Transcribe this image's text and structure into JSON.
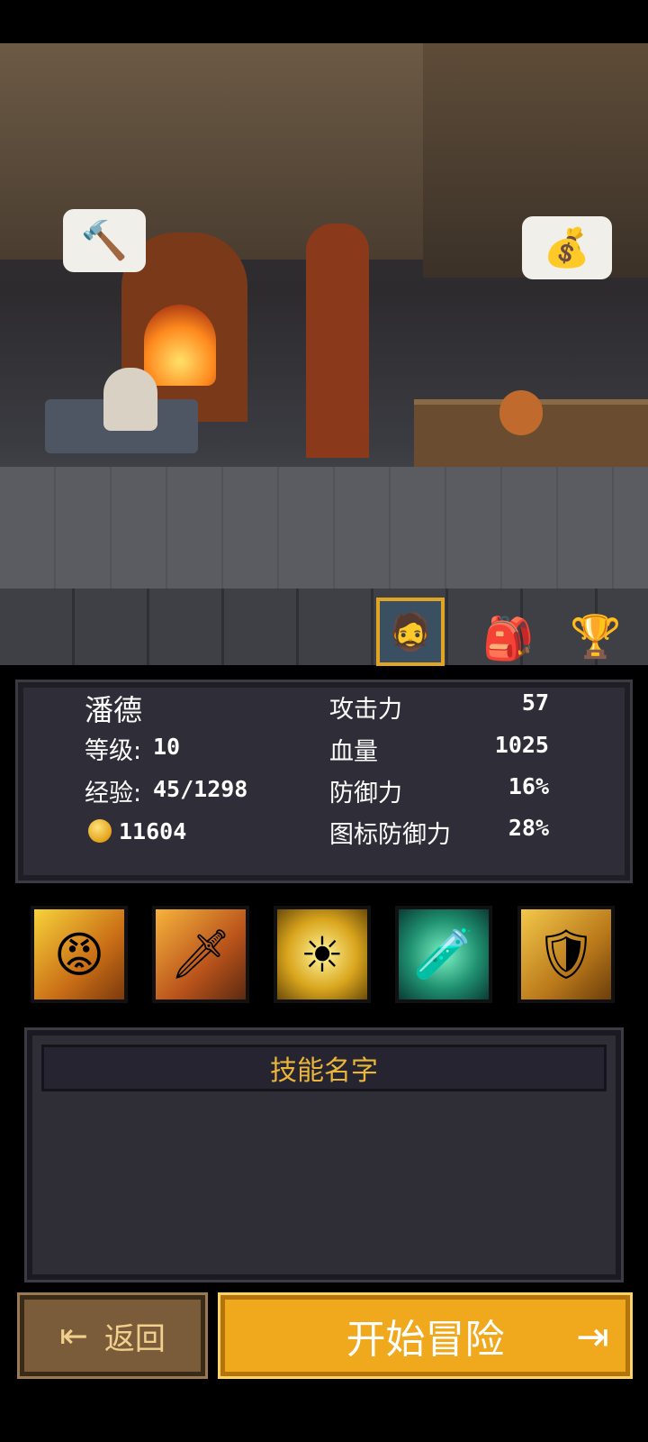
{
  "scene": {
    "hammer_icon": "hammer-icon",
    "gold_icon": "gold-bag-icon",
    "hammer_glyph": "🔨",
    "gold_glyph": "💰"
  },
  "tabs": {
    "portrait_glyph": "🧔",
    "bag_glyph": "🎒",
    "trophy_glyph": "🏆"
  },
  "character": {
    "name": "潘德",
    "level_label": "等级:",
    "level_value": "10",
    "exp_label": "经验:",
    "exp_value": "45/1298",
    "gold_value": "11604"
  },
  "attributes": [
    {
      "label": "攻击力",
      "value": "57"
    },
    {
      "label": "血量",
      "value": "1025"
    },
    {
      "label": "防御力",
      "value": "16%"
    },
    {
      "label": "图标防御力",
      "value": "28%"
    }
  ],
  "skills": [
    {
      "glyph": "😡"
    },
    {
      "glyph": "🗡"
    },
    {
      "glyph": "☀"
    },
    {
      "glyph": "🧪"
    },
    {
      "glyph": "🛡"
    }
  ],
  "skill_panel": {
    "title": "技能名字"
  },
  "buttons": {
    "back_label": "返回",
    "back_icon_glyph": "⇤",
    "start_label": "开始冒险",
    "start_icon_glyph": "⇥"
  },
  "colors": {
    "accent": "#f0a81d",
    "title_gold": "#e9b63a",
    "panel": "#2f2d37"
  }
}
